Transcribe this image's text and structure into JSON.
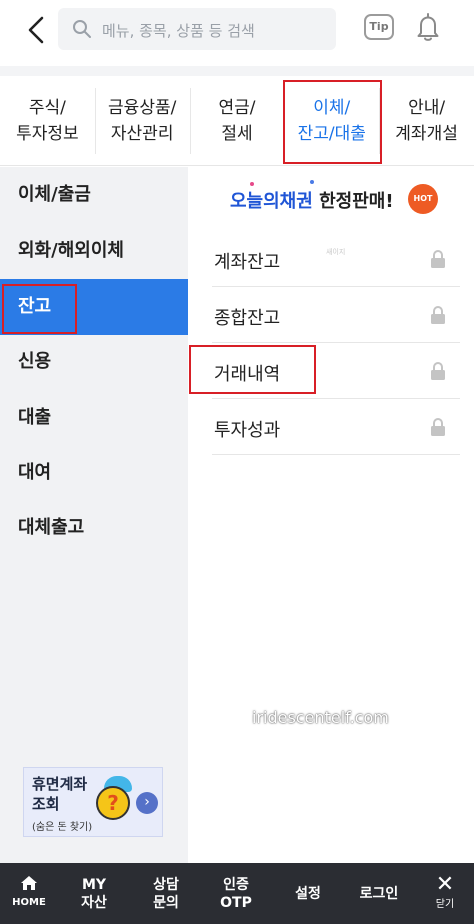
{
  "header": {
    "search_placeholder": "메뉴, 종목, 상품 등 검색",
    "tip_label": "Tip"
  },
  "tabs": [
    {
      "label": "주식/\n투자정보"
    },
    {
      "label": "금융상품/\n자산관리"
    },
    {
      "label": "연금/\n절세"
    },
    {
      "label": "이체/\n잔고/대출",
      "active": true
    },
    {
      "label": "안내/\n계좌개설"
    }
  ],
  "sidebar": {
    "items": [
      {
        "label": "이체/출금"
      },
      {
        "label": "외화/해외이체"
      },
      {
        "label": "잔고",
        "active": true
      },
      {
        "label": "신용"
      },
      {
        "label": "대출"
      },
      {
        "label": "대여"
      },
      {
        "label": "대체출고"
      }
    ],
    "banner": {
      "title": "휴면계좌\n조회",
      "subtitle": "(숨은 돈 찾기)",
      "icon": "question-mark-icon"
    }
  },
  "promo": {
    "highlight": "오늘의채권",
    "rest": " 한정판매!",
    "hot_label": "HOT"
  },
  "content": {
    "items": [
      {
        "label": "계좌잔고",
        "icon": "lock-icon"
      },
      {
        "label": "종합잔고",
        "icon": "lock-icon"
      },
      {
        "label": "거래내역",
        "icon": "lock-icon"
      },
      {
        "label": "투자성과",
        "icon": "lock-icon"
      }
    ],
    "tiny_text": "새이지"
  },
  "watermark": "iridescentelf.com",
  "bottom_bar": {
    "home_label": "HOME",
    "items": [
      {
        "label": "MY\n자산"
      },
      {
        "label": "상담\n문의"
      },
      {
        "label": "인증\nOTP"
      },
      {
        "label": "설정"
      },
      {
        "label": "로그인"
      }
    ],
    "close_label": "닫기"
  },
  "colors": {
    "accent": "#2b7be6",
    "highlight_box": "#d81f26",
    "bottom_bar": "#2b2d33",
    "sidebar_bg": "#f1f2f4",
    "promo_blue": "#1f55d6",
    "hot_badge": "#ee5b24"
  }
}
